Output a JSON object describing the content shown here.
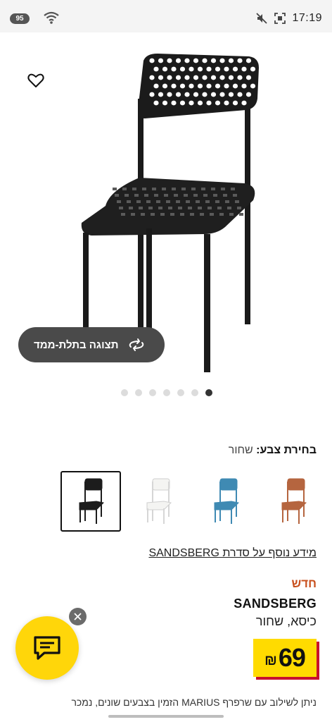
{
  "status_bar": {
    "battery": "95",
    "time": "17:19",
    "icons": [
      "battery-icon",
      "wifi-icon",
      "screenshot-icon",
      "mute-icon"
    ]
  },
  "hero": {
    "favorite_icon": "heart-outline-icon",
    "view_3d_label": "תצוגה בתלת-ממד",
    "view_3d_icon": "rotate-3d-icon",
    "image_dots_total": 7,
    "image_dots_active": 1
  },
  "color_choice": {
    "label": "בחירת צבע:",
    "value": "שחור",
    "swatches": [
      {
        "name": "black",
        "color": "#1c1c1c",
        "selected": true
      },
      {
        "name": "white",
        "color": "#f4f4f2",
        "selected": false
      },
      {
        "name": "blue",
        "color": "#3f8ab3",
        "selected": false
      },
      {
        "name": "brown",
        "color": "#b5653f",
        "selected": false
      }
    ]
  },
  "series_link": "מידע נוסף על סדרת SANDSBERG",
  "product": {
    "badge": "חדש",
    "name": "SANDSBERG",
    "description": "כיסא, שחור",
    "price_value": "69",
    "price_currency": "₪"
  },
  "chat": {
    "icon": "chat-bubble-icon",
    "close_icon": "close-icon"
  },
  "bottom_text": "ניתן לשילוב עם שרפרף MARIUS הזמין בצבעים שונים, נמכר",
  "colors": {
    "accent_yellow": "#ffdb00",
    "price_shadow": "#c8102e",
    "badge_orange": "#c8501e",
    "button_dark": "#4a4a4a"
  }
}
